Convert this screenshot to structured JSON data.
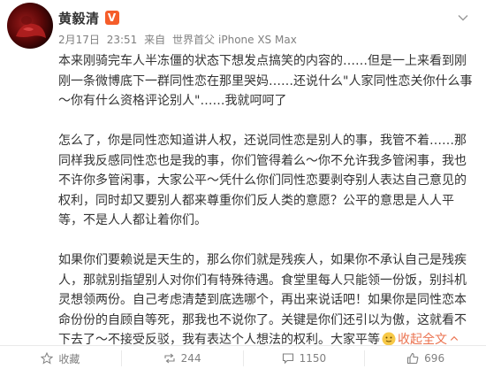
{
  "post": {
    "username": "黄毅清",
    "badge": "V",
    "meta": {
      "date": "2月17日",
      "time": "23:51",
      "from_label": "来自",
      "source": "世界首父",
      "device": "iPhone XS Max"
    },
    "paragraphs": [
      {
        "text_before": "本来刚骑完车人半冻僵的状态下想发点搞笑的内容的……但是一上来看到刚刚一条微博底下一群同性恋在那里哭妈……还说什么\"人家同性恋关你什么事～你有什么资格评论别人\"……我就呵呵了",
        "link": "",
        "text_after": ""
      },
      {
        "text_before": "怎么了，你是同性恋知道讲人权，还说同性恋是别人的事，我管不着……那同样我反感同性恋也是我的事，你们管得着么～你不允许我多管闲事，我也不许你多管闲事，大家公平～凭什么你们同性恋要剥夺别人表达自己意见的权利，同时却又要别人都来尊重你们反人类的意愿？公平的意思是人人平等，不是人人都让着你们。",
        "link": "",
        "text_after": ""
      },
      {
        "text_before": "如果你们要赖说是天生的，那么你们就是残疾人，如果你不承认自己是残疾人，那就别指望别人对你们有特殊待遇。食堂里每人只能领一份饭，别抖机灵想领两份。自己考虑清楚到底选哪个，再出来说话吧！如果你是同性恋本命份份的自顾自等死，那我也不说你了。关键是你们还引以为傲，这就看不下去了～不接受反驳，我有表达个人想法的权利。大家平等",
        "link": "收起全文",
        "text_after": ""
      }
    ],
    "actions": [
      {
        "label": "收藏",
        "icon": "star-icon"
      },
      {
        "label": "244",
        "icon": "repost-icon"
      },
      {
        "label": "1150",
        "icon": "comment-icon"
      },
      {
        "label": "696",
        "icon": "like-icon"
      }
    ],
    "colors": {
      "link": "#eb7350",
      "badge": "#f55d2a",
      "text": "#333333",
      "meta": "#808080"
    }
  }
}
